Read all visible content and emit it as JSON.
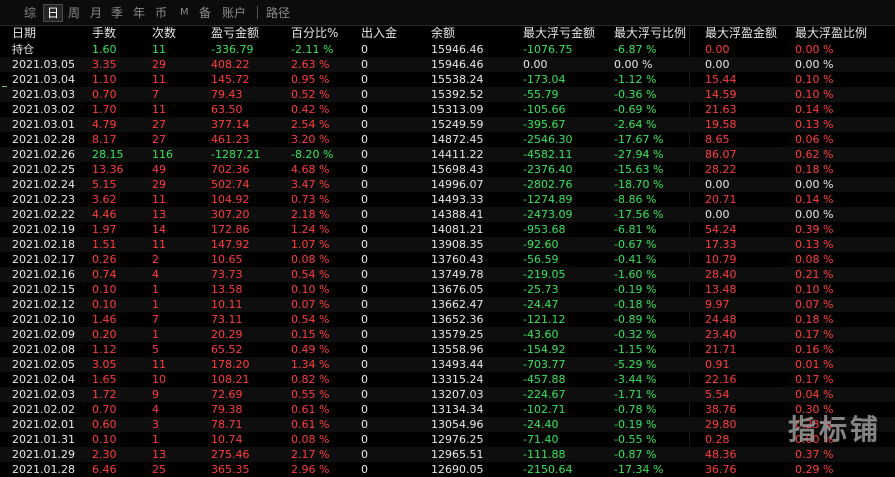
{
  "tabs": [
    "综",
    "日",
    "周",
    "月",
    "季",
    "年",
    "币",
    "M",
    "备",
    "账户",
    "路径"
  ],
  "active_tab": "日",
  "watermark": "指标铺",
  "colors": {
    "up": "#ff3c3c",
    "down": "#38e25c",
    "neutral": "#e6e6e6"
  },
  "columns": [
    "日期",
    "手数",
    "次数",
    "盈亏金额",
    "百分比%",
    "出入金",
    "余额",
    "最大浮亏金额",
    "最大浮亏比例",
    "最大浮盈金额",
    "最大浮盈比例"
  ],
  "rows": [
    {
      "date": "持仓",
      "lots": "1.60",
      "count": "11",
      "pnl": "-336.79",
      "pct": "-2.11 %",
      "inout": "0",
      "balance": "15946.46",
      "max_float_loss": "-1076.75",
      "max_float_loss_pct": "-6.87 %",
      "max_float_profit": "0.00",
      "max_float_profit_pct": "0.00 %",
      "tone": "g"
    },
    {
      "date": "2021.03.05",
      "lots": "3.35",
      "count": "29",
      "pnl": "408.22",
      "pct": "2.63 %",
      "inout": "0",
      "balance": "15946.46",
      "max_float_loss": "0.00",
      "max_float_loss_pct": "0.00 %",
      "max_float_profit": "0.00",
      "max_float_profit_pct": "0.00 %",
      "tone": "r",
      "flw": true,
      "fpw": true
    },
    {
      "date": "2021.03.04",
      "lots": "1.10",
      "count": "11",
      "pnl": "145.72",
      "pct": "0.95 %",
      "inout": "0",
      "balance": "15538.24",
      "max_float_loss": "-173.04",
      "max_float_loss_pct": "-1.12 %",
      "max_float_profit": "15.44",
      "max_float_profit_pct": "0.10 %",
      "tone": "r"
    },
    {
      "date": "2021.03.03",
      "lots": "0.70",
      "count": "7",
      "pnl": "79.43",
      "pct": "0.52 %",
      "inout": "0",
      "balance": "15392.52",
      "max_float_loss": "-55.79",
      "max_float_loss_pct": "-0.36 %",
      "max_float_profit": "14.59",
      "max_float_profit_pct": "0.10 %",
      "tone": "r"
    },
    {
      "date": "2021.03.02",
      "lots": "1.70",
      "count": "11",
      "pnl": "63.50",
      "pct": "0.42 %",
      "inout": "0",
      "balance": "15313.09",
      "max_float_loss": "-105.66",
      "max_float_loss_pct": "-0.69 %",
      "max_float_profit": "21.63",
      "max_float_profit_pct": "0.14 %",
      "tone": "r"
    },
    {
      "date": "2021.03.01",
      "lots": "4.79",
      "count": "27",
      "pnl": "377.14",
      "pct": "2.54 %",
      "inout": "0",
      "balance": "15249.59",
      "max_float_loss": "-395.67",
      "max_float_loss_pct": "-2.64 %",
      "max_float_profit": "19.58",
      "max_float_profit_pct": "0.13 %",
      "tone": "r"
    },
    {
      "date": "2021.02.28",
      "lots": "8.17",
      "count": "27",
      "pnl": "461.23",
      "pct": "3.20 %",
      "inout": "0",
      "balance": "14872.45",
      "max_float_loss": "-2546.30",
      "max_float_loss_pct": "-17.67 %",
      "max_float_profit": "8.65",
      "max_float_profit_pct": "0.06 %",
      "tone": "r"
    },
    {
      "date": "2021.02.26",
      "lots": "28.15",
      "count": "116",
      "pnl": "-1287.21",
      "pct": "-8.20 %",
      "inout": "0",
      "balance": "14411.22",
      "max_float_loss": "-4582.11",
      "max_float_loss_pct": "-27.94 %",
      "max_float_profit": "86.07",
      "max_float_profit_pct": "0.62 %",
      "tone": "g"
    },
    {
      "date": "2021.02.25",
      "lots": "13.36",
      "count": "49",
      "pnl": "702.36",
      "pct": "4.68 %",
      "inout": "0",
      "balance": "15698.43",
      "max_float_loss": "-2376.40",
      "max_float_loss_pct": "-15.63 %",
      "max_float_profit": "28.22",
      "max_float_profit_pct": "0.18 %",
      "tone": "r"
    },
    {
      "date": "2021.02.24",
      "lots": "5.15",
      "count": "29",
      "pnl": "502.74",
      "pct": "3.47 %",
      "inout": "0",
      "balance": "14996.07",
      "max_float_loss": "-2802.76",
      "max_float_loss_pct": "-18.70 %",
      "max_float_profit": "0.00",
      "max_float_profit_pct": "0.00 %",
      "tone": "r",
      "fpw": true
    },
    {
      "date": "2021.02.23",
      "lots": "3.62",
      "count": "11",
      "pnl": "104.92",
      "pct": "0.73 %",
      "inout": "0",
      "balance": "14493.33",
      "max_float_loss": "-1274.89",
      "max_float_loss_pct": "-8.86 %",
      "max_float_profit": "20.71",
      "max_float_profit_pct": "0.14 %",
      "tone": "r"
    },
    {
      "date": "2021.02.22",
      "lots": "4.46",
      "count": "13",
      "pnl": "307.20",
      "pct": "2.18 %",
      "inout": "0",
      "balance": "14388.41",
      "max_float_loss": "-2473.09",
      "max_float_loss_pct": "-17.56 %",
      "max_float_profit": "0.00",
      "max_float_profit_pct": "0.00 %",
      "tone": "r",
      "fpw": true
    },
    {
      "date": "2021.02.19",
      "lots": "1.97",
      "count": "14",
      "pnl": "172.86",
      "pct": "1.24 %",
      "inout": "0",
      "balance": "14081.21",
      "max_float_loss": "-953.68",
      "max_float_loss_pct": "-6.81 %",
      "max_float_profit": "54.24",
      "max_float_profit_pct": "0.39 %",
      "tone": "r"
    },
    {
      "date": "2021.02.18",
      "lots": "1.51",
      "count": "11",
      "pnl": "147.92",
      "pct": "1.07 %",
      "inout": "0",
      "balance": "13908.35",
      "max_float_loss": "-92.60",
      "max_float_loss_pct": "-0.67 %",
      "max_float_profit": "17.33",
      "max_float_profit_pct": "0.13 %",
      "tone": "r"
    },
    {
      "date": "2021.02.17",
      "lots": "0.26",
      "count": "2",
      "pnl": "10.65",
      "pct": "0.08 %",
      "inout": "0",
      "balance": "13760.43",
      "max_float_loss": "-56.59",
      "max_float_loss_pct": "-0.41 %",
      "max_float_profit": "10.79",
      "max_float_profit_pct": "0.08 %",
      "tone": "r"
    },
    {
      "date": "2021.02.16",
      "lots": "0.74",
      "count": "4",
      "pnl": "73.73",
      "pct": "0.54 %",
      "inout": "0",
      "balance": "13749.78",
      "max_float_loss": "-219.05",
      "max_float_loss_pct": "-1.60 %",
      "max_float_profit": "28.40",
      "max_float_profit_pct": "0.21 %",
      "tone": "r"
    },
    {
      "date": "2021.02.15",
      "lots": "0.10",
      "count": "1",
      "pnl": "13.58",
      "pct": "0.10 %",
      "inout": "0",
      "balance": "13676.05",
      "max_float_loss": "-25.73",
      "max_float_loss_pct": "-0.19 %",
      "max_float_profit": "13.48",
      "max_float_profit_pct": "0.10 %",
      "tone": "r"
    },
    {
      "date": "2021.02.12",
      "lots": "0.10",
      "count": "1",
      "pnl": "10.11",
      "pct": "0.07 %",
      "inout": "0",
      "balance": "13662.47",
      "max_float_loss": "-24.47",
      "max_float_loss_pct": "-0.18 %",
      "max_float_profit": "9.97",
      "max_float_profit_pct": "0.07 %",
      "tone": "r"
    },
    {
      "date": "2021.02.10",
      "lots": "1.46",
      "count": "7",
      "pnl": "73.11",
      "pct": "0.54 %",
      "inout": "0",
      "balance": "13652.36",
      "max_float_loss": "-121.12",
      "max_float_loss_pct": "-0.89 %",
      "max_float_profit": "24.48",
      "max_float_profit_pct": "0.18 %",
      "tone": "r"
    },
    {
      "date": "2021.02.09",
      "lots": "0.20",
      "count": "1",
      "pnl": "20.29",
      "pct": "0.15 %",
      "inout": "0",
      "balance": "13579.25",
      "max_float_loss": "-43.60",
      "max_float_loss_pct": "-0.32 %",
      "max_float_profit": "23.40",
      "max_float_profit_pct": "0.17 %",
      "tone": "r"
    },
    {
      "date": "2021.02.08",
      "lots": "1.12",
      "count": "5",
      "pnl": "65.52",
      "pct": "0.49 %",
      "inout": "0",
      "balance": "13558.96",
      "max_float_loss": "-154.92",
      "max_float_loss_pct": "-1.15 %",
      "max_float_profit": "21.71",
      "max_float_profit_pct": "0.16 %",
      "tone": "r"
    },
    {
      "date": "2021.02.05",
      "lots": "3.05",
      "count": "11",
      "pnl": "178.20",
      "pct": "1.34 %",
      "inout": "0",
      "balance": "13493.44",
      "max_float_loss": "-703.77",
      "max_float_loss_pct": "-5.29 %",
      "max_float_profit": "0.91",
      "max_float_profit_pct": "0.01 %",
      "tone": "r"
    },
    {
      "date": "2021.02.04",
      "lots": "1.65",
      "count": "10",
      "pnl": "108.21",
      "pct": "0.82 %",
      "inout": "0",
      "balance": "13315.24",
      "max_float_loss": "-457.88",
      "max_float_loss_pct": "-3.44 %",
      "max_float_profit": "22.16",
      "max_float_profit_pct": "0.17 %",
      "tone": "r"
    },
    {
      "date": "2021.02.03",
      "lots": "1.72",
      "count": "9",
      "pnl": "72.69",
      "pct": "0.55 %",
      "inout": "0",
      "balance": "13207.03",
      "max_float_loss": "-224.67",
      "max_float_loss_pct": "-1.71 %",
      "max_float_profit": "5.54",
      "max_float_profit_pct": "0.04 %",
      "tone": "r"
    },
    {
      "date": "2021.02.02",
      "lots": "0.70",
      "count": "4",
      "pnl": "79.38",
      "pct": "0.61 %",
      "inout": "0",
      "balance": "13134.34",
      "max_float_loss": "-102.71",
      "max_float_loss_pct": "-0.78 %",
      "max_float_profit": "38.76",
      "max_float_profit_pct": "0.30 %",
      "tone": "r"
    },
    {
      "date": "2021.02.01",
      "lots": "0.60",
      "count": "3",
      "pnl": "78.71",
      "pct": "0.61 %",
      "inout": "0",
      "balance": "13054.96",
      "max_float_loss": "-24.40",
      "max_float_loss_pct": "-0.19 %",
      "max_float_profit": "29.80",
      "max_float_profit_pct": "0.23 %",
      "tone": "r"
    },
    {
      "date": "2021.01.31",
      "lots": "0.10",
      "count": "1",
      "pnl": "10.74",
      "pct": "0.08 %",
      "inout": "0",
      "balance": "12976.25",
      "max_float_loss": "-71.40",
      "max_float_loss_pct": "-0.55 %",
      "max_float_profit": "0.28",
      "max_float_profit_pct": "0.00 %",
      "tone": "r"
    },
    {
      "date": "2021.01.29",
      "lots": "2.30",
      "count": "13",
      "pnl": "275.46",
      "pct": "2.17 %",
      "inout": "0",
      "balance": "12965.51",
      "max_float_loss": "-111.88",
      "max_float_loss_pct": "-0.87 %",
      "max_float_profit": "48.36",
      "max_float_profit_pct": "0.37 %",
      "tone": "r"
    },
    {
      "date": "2021.01.28",
      "lots": "6.46",
      "count": "25",
      "pnl": "365.35",
      "pct": "2.96 %",
      "inout": "0",
      "balance": "12690.05",
      "max_float_loss": "-2150.64",
      "max_float_loss_pct": "-17.34 %",
      "max_float_profit": "36.76",
      "max_float_profit_pct": "0.29 %",
      "tone": "r"
    }
  ]
}
